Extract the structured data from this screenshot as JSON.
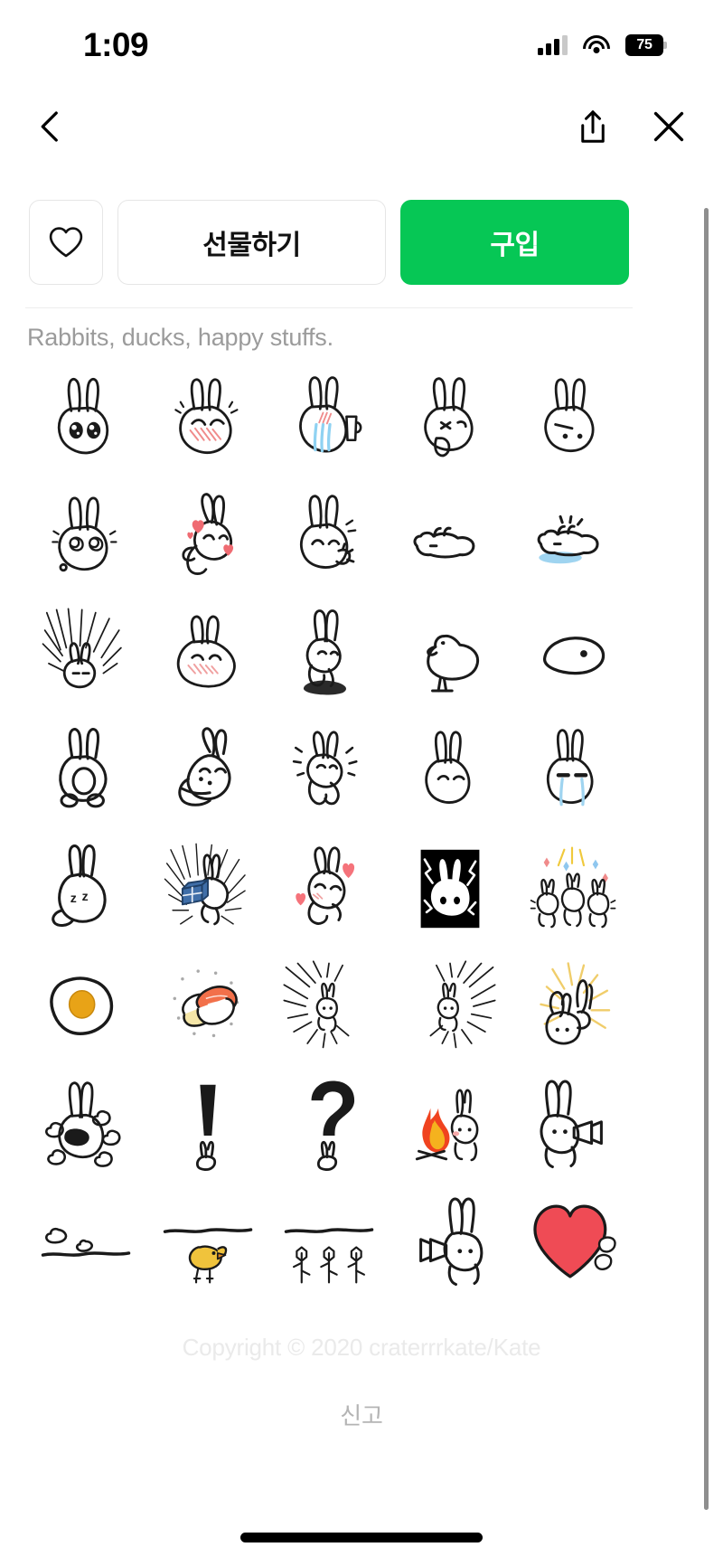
{
  "status_bar": {
    "time": "1:09",
    "battery_percent": "75",
    "icons": [
      "cellular-signal-icon",
      "wifi-icon",
      "battery-icon"
    ]
  },
  "nav_bar": {
    "back_label": "back-chevron-icon",
    "share_label": "share-icon",
    "close_label": "close-icon"
  },
  "actions": {
    "favorite_label": "heart-outline-icon",
    "gift_label": "선물하기",
    "buy_label": "구입",
    "buy_color": "#06c755",
    "border_color": "#e6e6e6"
  },
  "product": {
    "description": "Rabbits, ducks, happy stuffs.",
    "copyright": "Copyright © 2020 craterrrkate/Kate",
    "report_label": "신고"
  },
  "stickers": {
    "columns": 5,
    "rows": 8,
    "items": [
      {
        "id": 1,
        "name": "rabbit-sparkle-eyes"
      },
      {
        "id": 2,
        "name": "rabbit-blushing"
      },
      {
        "id": 3,
        "name": "rabbit-crying-with-cup"
      },
      {
        "id": 4,
        "name": "rabbit-sticking-tongue-out"
      },
      {
        "id": 5,
        "name": "rabbit-annoyed-face"
      },
      {
        "id": 6,
        "name": "rabbit-dizzy-eyes"
      },
      {
        "id": 7,
        "name": "rabbit-hugging-with-hearts"
      },
      {
        "id": 8,
        "name": "rabbit-waving-happy"
      },
      {
        "id": 9,
        "name": "rabbit-lying-flat"
      },
      {
        "id": 10,
        "name": "rabbit-lying-in-puddle"
      },
      {
        "id": 11,
        "name": "rabbit-excited-burst"
      },
      {
        "id": 12,
        "name": "rabbit-melting-blush"
      },
      {
        "id": 13,
        "name": "rabbit-sitting-shadow"
      },
      {
        "id": 14,
        "name": "duck-walking"
      },
      {
        "id": 15,
        "name": "duck-head-closeup"
      },
      {
        "id": 16,
        "name": "rabbit-back-view-tail"
      },
      {
        "id": 17,
        "name": "rabbit-wrapped-in-blanket"
      },
      {
        "id": 18,
        "name": "rabbit-jumping-joy"
      },
      {
        "id": 19,
        "name": "rabbit-sad-face"
      },
      {
        "id": 20,
        "name": "rabbit-crying-tears"
      },
      {
        "id": 21,
        "name": "rabbit-sleeping-zzz"
      },
      {
        "id": 22,
        "name": "rabbit-carrying-gift-box"
      },
      {
        "id": 23,
        "name": "rabbit-laughing-hearts"
      },
      {
        "id": 24,
        "name": "rabbit-shocked-inverted"
      },
      {
        "id": 25,
        "name": "rabbits-celebrating-sparkles"
      },
      {
        "id": 26,
        "name": "fried-egg"
      },
      {
        "id": 27,
        "name": "sushi-nigiri"
      },
      {
        "id": 28,
        "name": "rabbit-running-left-speedlines"
      },
      {
        "id": 29,
        "name": "rabbit-running-right-speedlines"
      },
      {
        "id": 30,
        "name": "rabbit-pointing-up-rays"
      },
      {
        "id": 31,
        "name": "rabbit-shouting-clouds"
      },
      {
        "id": 32,
        "name": "exclamation-mark-rabbit"
      },
      {
        "id": 33,
        "name": "question-mark-rabbit"
      },
      {
        "id": 34,
        "name": "rabbit-by-campfire"
      },
      {
        "id": 35,
        "name": "rabbit-with-megaphone-right"
      },
      {
        "id": 36,
        "name": "horizon-with-clouds"
      },
      {
        "id": 37,
        "name": "horizon-with-chick"
      },
      {
        "id": 38,
        "name": "horizon-with-flowers"
      },
      {
        "id": 39,
        "name": "rabbit-with-megaphone-left"
      },
      {
        "id": 40,
        "name": "red-heart-with-paws"
      }
    ]
  },
  "colors": {
    "brand_green": "#06c755",
    "text_primary": "#111111",
    "text_muted": "#9b9b9b",
    "heart_red": "#ef4b55",
    "egg_yolk": "#e8a317",
    "salmon": "#f2704a",
    "gift_blue": "#3f6ea8",
    "tear_blue": "#9fd4f0",
    "chick_yellow": "#f0c33c",
    "fire_orange": "#f0572a"
  }
}
